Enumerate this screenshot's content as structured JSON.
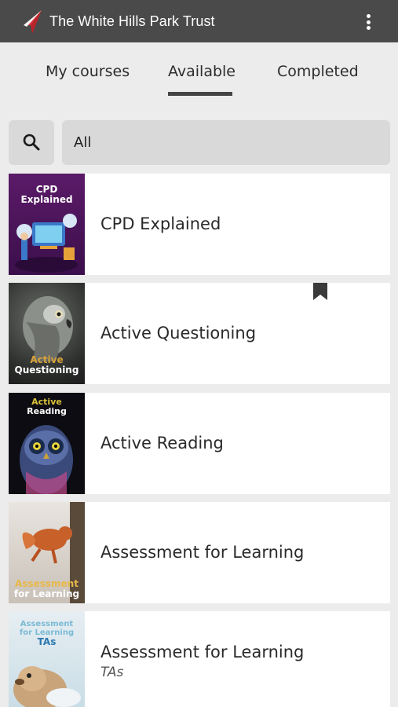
{
  "appbar": {
    "title": "The White Hills Park Trust",
    "logo_icon": "paper-plane-logo",
    "menu_icon": "more-vert-icon"
  },
  "tabs": [
    {
      "label": "My courses",
      "active": false
    },
    {
      "label": "Available",
      "active": true
    },
    {
      "label": "Completed",
      "active": false
    }
  ],
  "search": {
    "icon": "search-icon",
    "filter_value": "All"
  },
  "courses": [
    {
      "title": "CPD Explained",
      "subtitle": "",
      "thumb_lines": [
        "CPD",
        "Explained"
      ],
      "bookmarked": false
    },
    {
      "title": "Active Questioning",
      "subtitle": "",
      "thumb_lines": [
        "Active",
        "Questioning"
      ],
      "bookmarked": true
    },
    {
      "title": "Active Reading",
      "subtitle": "",
      "thumb_lines": [
        "Active",
        "Reading"
      ],
      "bookmarked": false
    },
    {
      "title": "Assessment for Learning",
      "subtitle": "",
      "thumb_lines": [
        "Assessment",
        "for Learning"
      ],
      "bookmarked": false
    },
    {
      "title": "Assessment for Learning",
      "subtitle": "TAs",
      "thumb_lines": [
        "Assessment",
        "for Learning",
        "TAs"
      ],
      "bookmarked": false
    }
  ],
  "colors": {
    "appbar": "#4a4a4a",
    "background": "#ececec",
    "accent_red": "#e0343b"
  }
}
